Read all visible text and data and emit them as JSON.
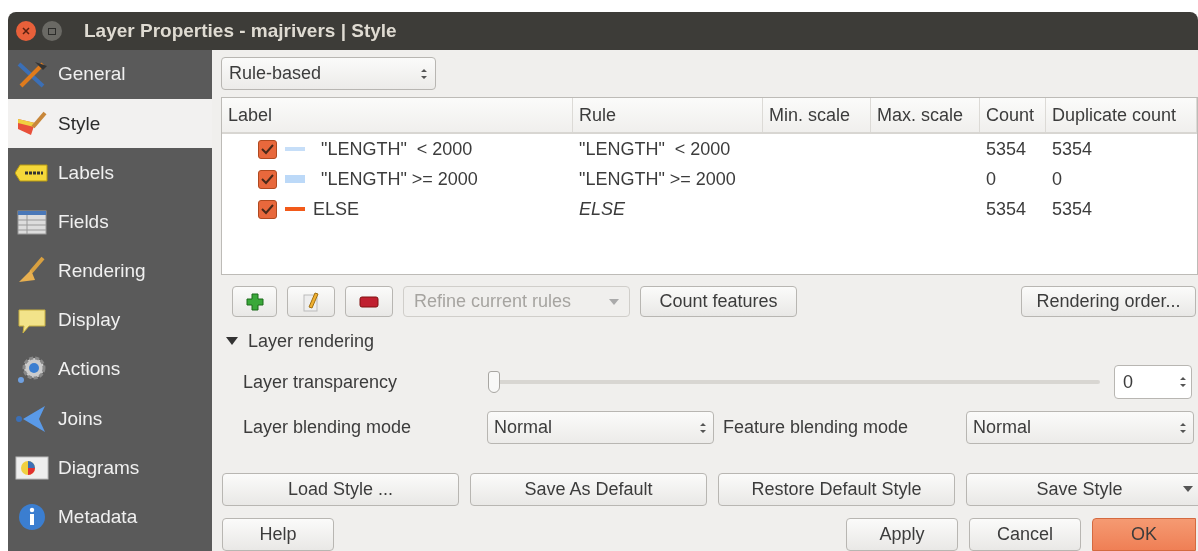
{
  "window": {
    "title": "Layer Properties - majrivers | Style"
  },
  "sidebar": {
    "items": [
      {
        "label": "General",
        "selected": false
      },
      {
        "label": "Style",
        "selected": true
      },
      {
        "label": "Labels",
        "selected": false
      },
      {
        "label": "Fields",
        "selected": false
      },
      {
        "label": "Rendering",
        "selected": false
      },
      {
        "label": "Display",
        "selected": false
      },
      {
        "label": "Actions",
        "selected": false
      },
      {
        "label": "Joins",
        "selected": false
      },
      {
        "label": "Diagrams",
        "selected": false
      },
      {
        "label": "Metadata",
        "selected": false
      }
    ]
  },
  "renderer": {
    "value": "Rule-based"
  },
  "table": {
    "columns": [
      "Label",
      "Rule",
      "Min. scale",
      "Max. scale",
      "Count",
      "Duplicate count"
    ],
    "rows": [
      {
        "checked": true,
        "color": "#c6def8",
        "label": "\"LENGTH\"  < 2000",
        "rule": "\"LENGTH\"  < 2000",
        "kind": "filter",
        "count": "5354",
        "duplicate_count": "5354"
      },
      {
        "checked": true,
        "color": "#bcd9f8",
        "label": "\"LENGTH\" >= 2000",
        "rule": "\"LENGTH\" >= 2000",
        "kind": "filter",
        "count": "0",
        "duplicate_count": "0"
      },
      {
        "checked": true,
        "color": "#f25a1a",
        "label": "ELSE",
        "rule": "ELSE",
        "kind": "else",
        "count": "5354",
        "duplicate_count": "5354"
      }
    ]
  },
  "rule_toolbar": {
    "refine": {
      "label": "Refine current rules",
      "disabled": true
    },
    "count_button": "Count features",
    "order_button": "Rendering order..."
  },
  "layer_rendering": {
    "title": "Layer rendering",
    "expanded": true,
    "transparency": {
      "label": "Layer transparency",
      "level": 0,
      "value": "0"
    },
    "layer_blending": {
      "label": "Layer blending mode",
      "value": "Normal"
    },
    "feature_blending": {
      "label": "Feature blending mode",
      "value": "Normal"
    }
  },
  "style_buttons": [
    "Load Style ...",
    "Save As Default",
    "Restore Default Style",
    "Save Style"
  ],
  "buttons": {
    "help": "Help",
    "apply": "Apply",
    "cancel": "Cancel",
    "ok": "OK"
  }
}
